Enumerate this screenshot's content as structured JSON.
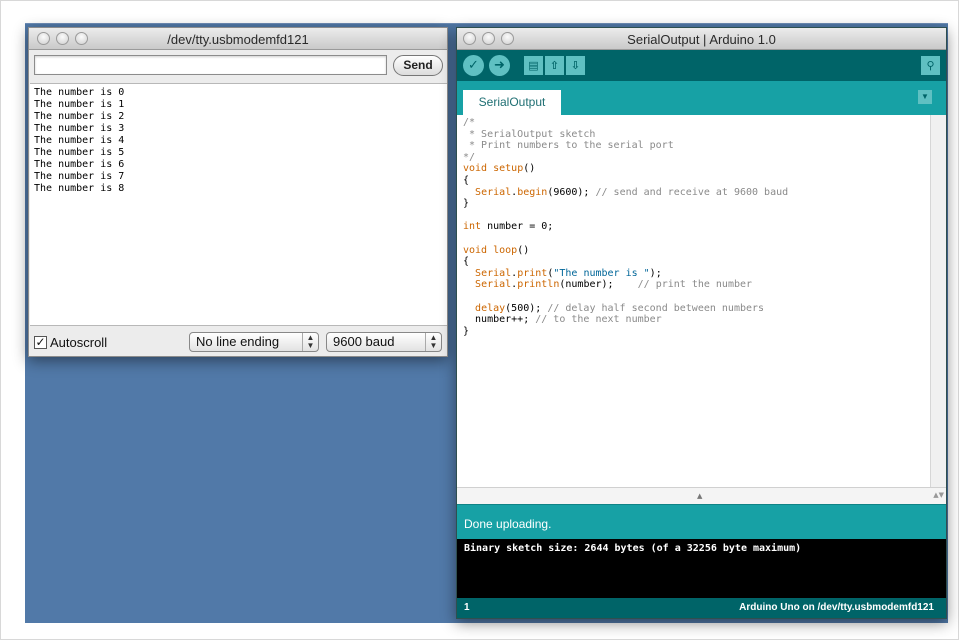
{
  "serial_monitor": {
    "title": "/dev/tty.usbmodemfd121",
    "input_value": "",
    "send_label": "Send",
    "lines": [
      "The number is 0",
      "The number is 1",
      "The number is 2",
      "The number is 3",
      "The number is 4",
      "The number is 5",
      "The number is 6",
      "The number is 7",
      "The number is 8"
    ],
    "autoscroll_label": "Autoscroll",
    "autoscroll_checked": true,
    "checkmark_glyph": "✓",
    "line_ending": "No line ending",
    "baud": "9600 baud"
  },
  "ide": {
    "title": "SerialOutput | Arduino 1.0",
    "toolbar": {
      "verify_icon": "check-icon",
      "upload_icon": "arrow-right-icon",
      "new_icon": "document-icon",
      "open_icon": "arrow-up-icon",
      "save_icon": "arrow-down-icon",
      "serial_monitor_icon": "magnifier-icon"
    },
    "tab_label": "SerialOutput",
    "code_lines": [
      [
        {
          "t": "/*",
          "c": "cm"
        }
      ],
      [
        {
          "t": " * SerialOutput sketch",
          "c": "cm"
        }
      ],
      [
        {
          "t": " * Print numbers to the serial port",
          "c": "cm"
        }
      ],
      [
        {
          "t": "*/",
          "c": "cm"
        }
      ],
      [
        {
          "t": "void",
          "c": "kw"
        },
        {
          "t": " ",
          "c": "plain"
        },
        {
          "t": "setup",
          "c": "fn"
        },
        {
          "t": "()",
          "c": "plain"
        }
      ],
      [
        {
          "t": "{",
          "c": "plain"
        }
      ],
      [
        {
          "t": "  ",
          "c": "plain"
        },
        {
          "t": "Serial",
          "c": "kw"
        },
        {
          "t": ".",
          "c": "plain"
        },
        {
          "t": "begin",
          "c": "fn"
        },
        {
          "t": "(9600); ",
          "c": "plain"
        },
        {
          "t": "// send and receive at 9600 baud",
          "c": "cm"
        }
      ],
      [
        {
          "t": "}",
          "c": "plain"
        }
      ],
      [
        {
          "t": "",
          "c": "plain"
        }
      ],
      [
        {
          "t": "int",
          "c": "kw"
        },
        {
          "t": " number = 0;",
          "c": "plain"
        }
      ],
      [
        {
          "t": "",
          "c": "plain"
        }
      ],
      [
        {
          "t": "void",
          "c": "kw"
        },
        {
          "t": " ",
          "c": "plain"
        },
        {
          "t": "loop",
          "c": "fn"
        },
        {
          "t": "()",
          "c": "plain"
        }
      ],
      [
        {
          "t": "{",
          "c": "plain"
        }
      ],
      [
        {
          "t": "  ",
          "c": "plain"
        },
        {
          "t": "Serial",
          "c": "kw"
        },
        {
          "t": ".",
          "c": "plain"
        },
        {
          "t": "print",
          "c": "fn"
        },
        {
          "t": "(",
          "c": "plain"
        },
        {
          "t": "\"The number is \"",
          "c": "str"
        },
        {
          "t": ");",
          "c": "plain"
        }
      ],
      [
        {
          "t": "  ",
          "c": "plain"
        },
        {
          "t": "Serial",
          "c": "kw"
        },
        {
          "t": ".",
          "c": "plain"
        },
        {
          "t": "println",
          "c": "fn"
        },
        {
          "t": "(number);    ",
          "c": "plain"
        },
        {
          "t": "// print the number",
          "c": "cm"
        }
      ],
      [
        {
          "t": "",
          "c": "plain"
        }
      ],
      [
        {
          "t": "  ",
          "c": "plain"
        },
        {
          "t": "delay",
          "c": "fn"
        },
        {
          "t": "(500); ",
          "c": "plain"
        },
        {
          "t": "// delay half second between numbers",
          "c": "cm"
        }
      ],
      [
        {
          "t": "  number++; ",
          "c": "plain"
        },
        {
          "t": "// to the next number",
          "c": "cm"
        }
      ],
      [
        {
          "t": "}",
          "c": "plain"
        }
      ]
    ],
    "status": "Done uploading.",
    "console": "Binary sketch size: 2644 bytes (of a 32256 byte maximum)",
    "line_number": "1",
    "board_info": "Arduino Uno on /dev/tty.usbmodemfd121"
  },
  "colors": {
    "desktop": "#5179a8",
    "ide_dark_teal": "#006468",
    "ide_teal": "#17a1a5",
    "ide_icon": "#5fc0c2",
    "keyword": "#cc6600",
    "string": "#006699",
    "comment": "#8a8a8a"
  }
}
